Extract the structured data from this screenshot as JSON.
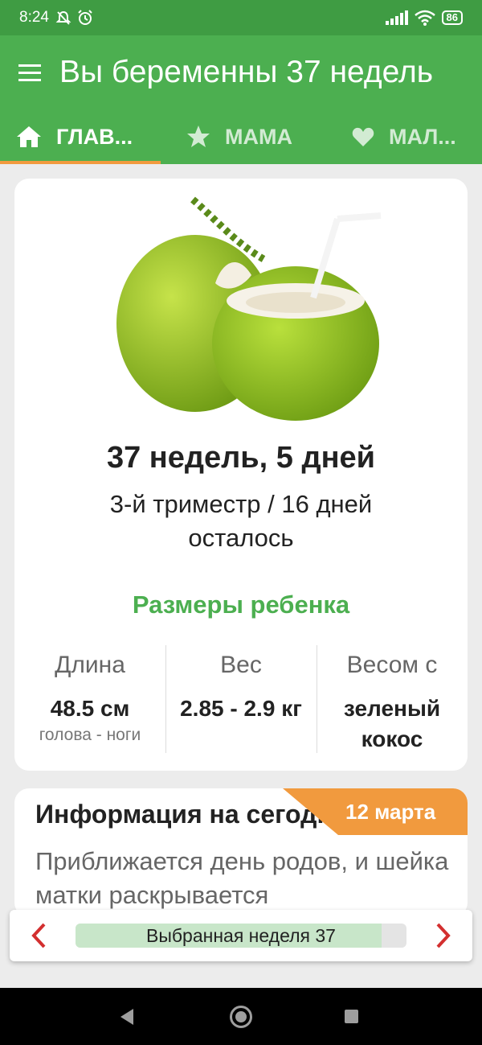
{
  "status_bar": {
    "time": "8:24",
    "battery": "86"
  },
  "app_bar": {
    "title": "Вы беременны 37 недель"
  },
  "tabs": [
    {
      "label": "ГЛАВ...",
      "icon": "home-icon"
    },
    {
      "label": "МАМА",
      "icon": "star-icon"
    },
    {
      "label": "МАЛ...",
      "icon": "heart-icon"
    }
  ],
  "week_card": {
    "image": "green-coconut",
    "weeks_days": "37 недель, 5 дней",
    "trimester": "3-й триместр / 16 дней осталось",
    "sizes_title": "Размеры ребенка",
    "stats": [
      {
        "header": "Длина",
        "value": "48.5 см",
        "sub": "голова - ноги"
      },
      {
        "header": "Вес",
        "value": "2.85 - 2.9 кг",
        "sub": ""
      },
      {
        "header": "Весом с",
        "value": "зеленый кокос",
        "sub": ""
      }
    ]
  },
  "info_card": {
    "date": "12 марта",
    "title": "Информация на сегодня",
    "text": "Приближается день родов, и шейка матки раскрывается"
  },
  "week_selector": {
    "label": "Выбранная неделя 37",
    "progress": 0.925
  },
  "colors": {
    "primary": "#4caf50",
    "status_bar": "#3f9c43",
    "accent": "#f19a3e",
    "arrow": "#d32f2f"
  }
}
